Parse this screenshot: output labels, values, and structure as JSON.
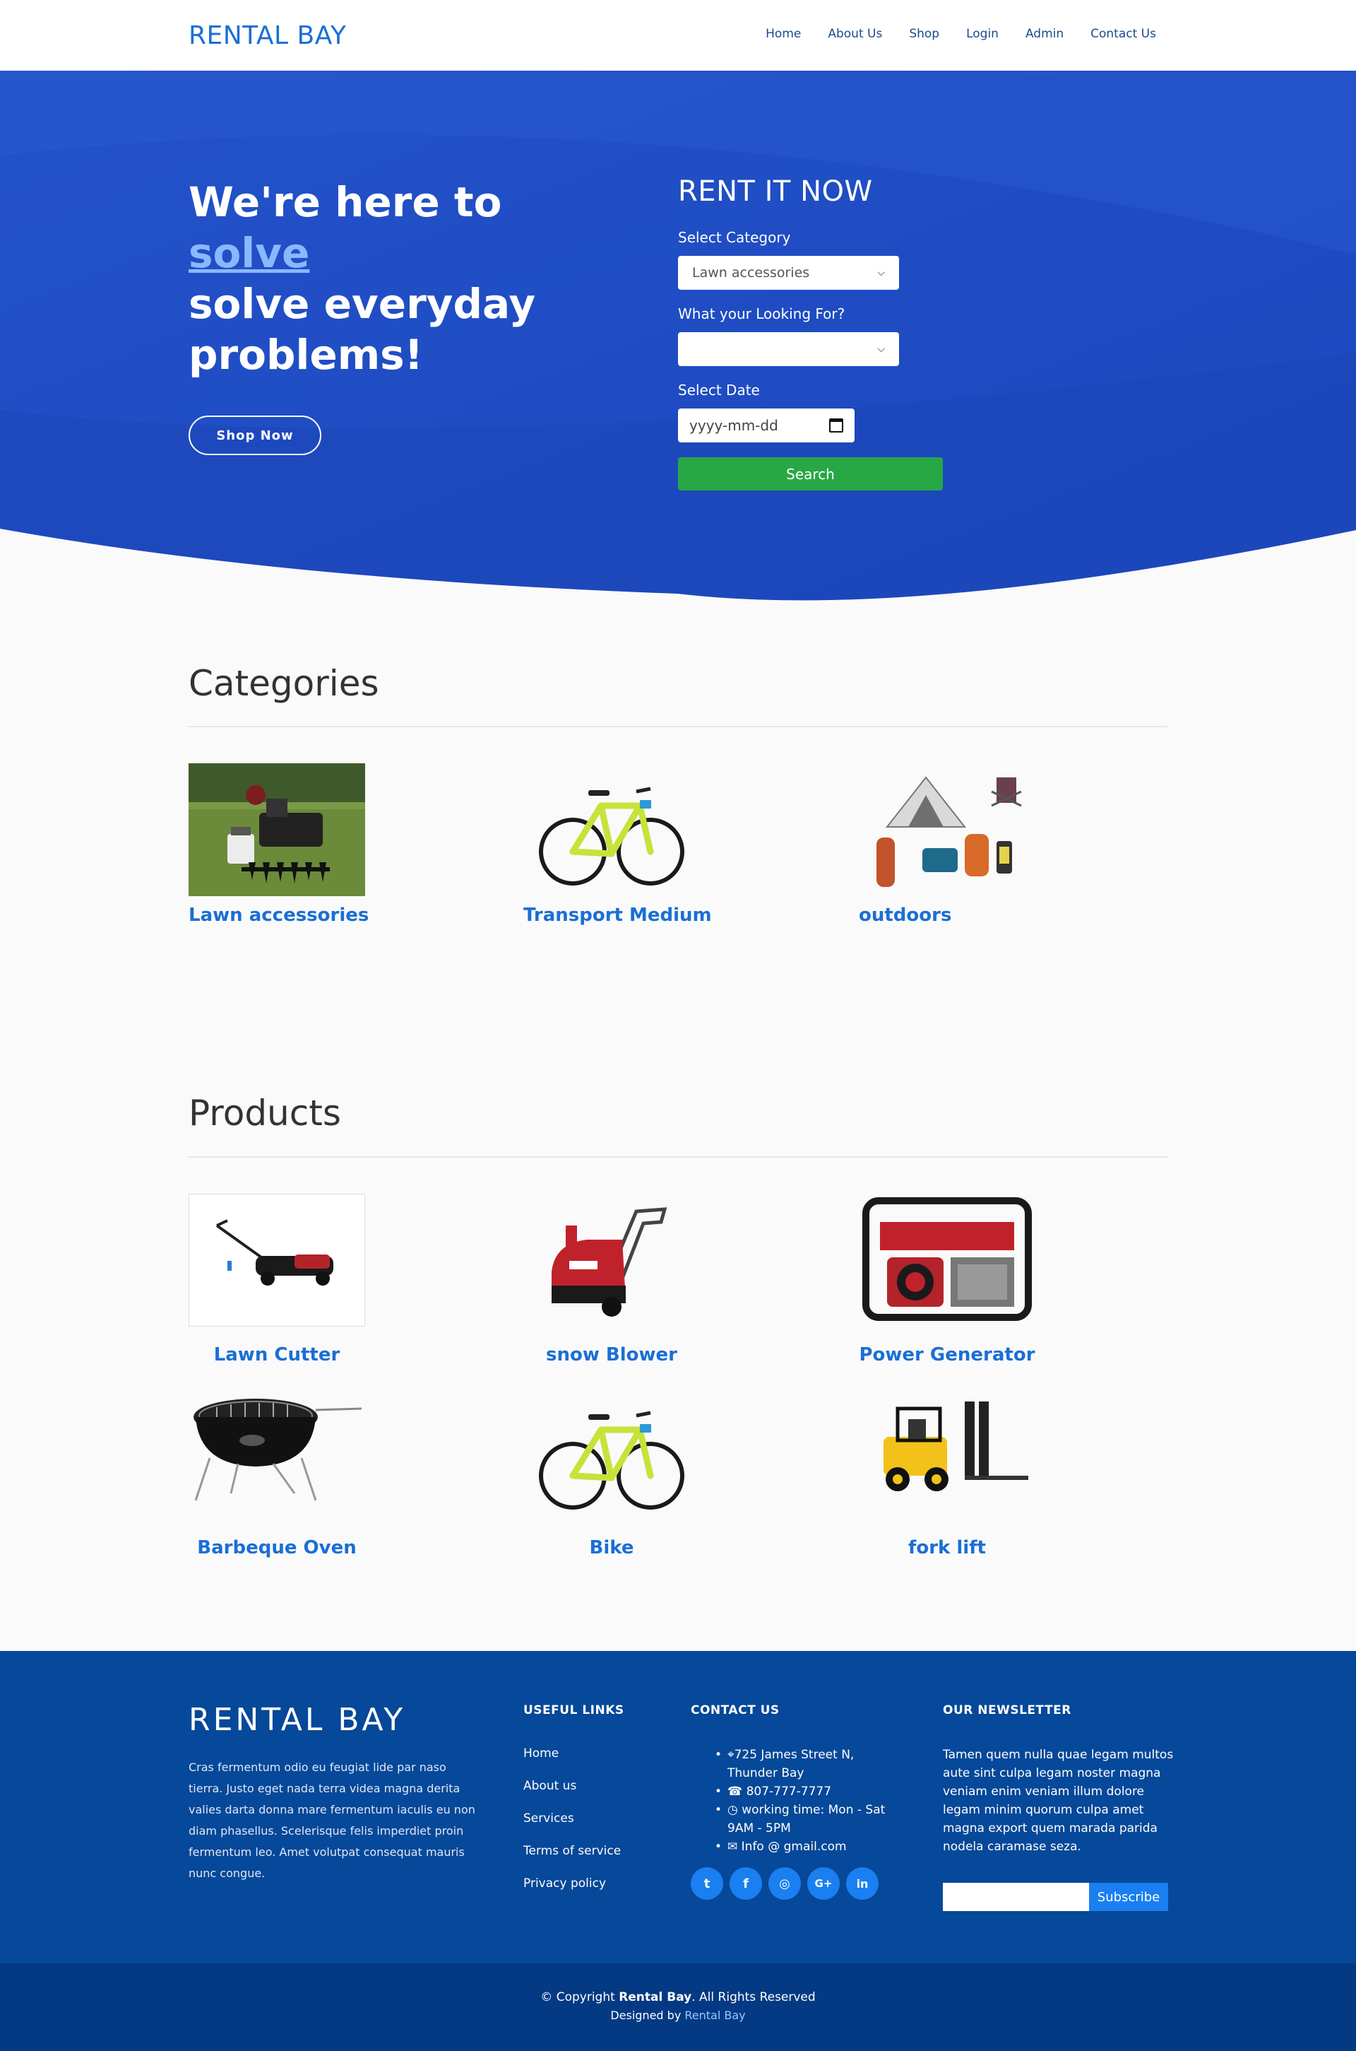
{
  "nav": {
    "brand": "RENTAL BAY",
    "links": [
      "Home",
      "About Us",
      "Shop",
      "Login",
      "Admin",
      "Contact Us"
    ]
  },
  "hero": {
    "line1": "We're here to",
    "highlight": "solve",
    "line2": "solve everyday",
    "line3": "problems!",
    "shop_button": "Shop Now",
    "form": {
      "title": "RENT IT NOW",
      "category_label": "Select Category",
      "category_value": "Lawn accessories",
      "looking_label": "What your Looking For?",
      "looking_value": "",
      "date_label": "Select Date",
      "date_placeholder": "yyyy-mm-dd",
      "search_button": "Search"
    }
  },
  "categories": {
    "title": "Categories",
    "items": [
      {
        "label": "Lawn accessories",
        "icon": "lawn-aerator-image"
      },
      {
        "label": "Transport Medium",
        "icon": "bicycle-image"
      },
      {
        "label": "outdoors",
        "icon": "camping-gear-image"
      }
    ]
  },
  "products": {
    "title": "Products",
    "items": [
      {
        "label": "Lawn Cutter",
        "icon": "lawn-mower-image"
      },
      {
        "label": "snow Blower",
        "icon": "snow-blower-image"
      },
      {
        "label": "Power Generator",
        "icon": "generator-image"
      },
      {
        "label": "Barbeque Oven",
        "icon": "barbeque-grill-image"
      },
      {
        "label": "Bike",
        "icon": "bicycle-image"
      },
      {
        "label": "fork lift",
        "icon": "forklift-image"
      }
    ]
  },
  "footer": {
    "brand": "RENTAL BAY",
    "about": "Cras fermentum odio eu feugiat lide par naso tierra. Justo eget nada terra videa magna derita valies darta donna mare fermentum iaculis eu non diam phasellus. Scelerisque felis imperdiet proin fermentum leo. Amet volutpat consequat mauris nunc congue.",
    "useful_links_title": "USEFUL LINKS",
    "useful_links": [
      "Home",
      "About us",
      "Services",
      "Terms of service",
      "Privacy policy"
    ],
    "contact_title": "CONTACT US",
    "contact": {
      "address": "725 James Street N, Thunder Bay",
      "phone": "807-777-7777",
      "hours": "working time: Mon - Sat 9AM - 5PM",
      "email": "Info @ gmail.com"
    },
    "socials": [
      "twitter-icon",
      "facebook-icon",
      "instagram-icon",
      "google-plus-icon",
      "linkedin-icon"
    ],
    "newsletter_title": "OUR NEWSLETTER",
    "newsletter_text": "Tamen quem nulla quae legam multos aute sint culpa legam noster magna veniam enim veniam illum dolore legam minim quorum culpa amet magna export quem marada parida nodela caramase seza.",
    "subscribe_button": "Subscribe",
    "copyright_prefix": "© Copyright",
    "copyright_brand": "Rental Bay",
    "copyright_suffix": ". All Rights Reserved",
    "designed_by_prefix": "Designed by",
    "designed_by": "Rental Bay"
  },
  "colors": {
    "brand_blue": "#1a6fd4",
    "hero_blue": "#1f4fc4",
    "search_green": "#28a745",
    "footer_blue": "#064899"
  }
}
